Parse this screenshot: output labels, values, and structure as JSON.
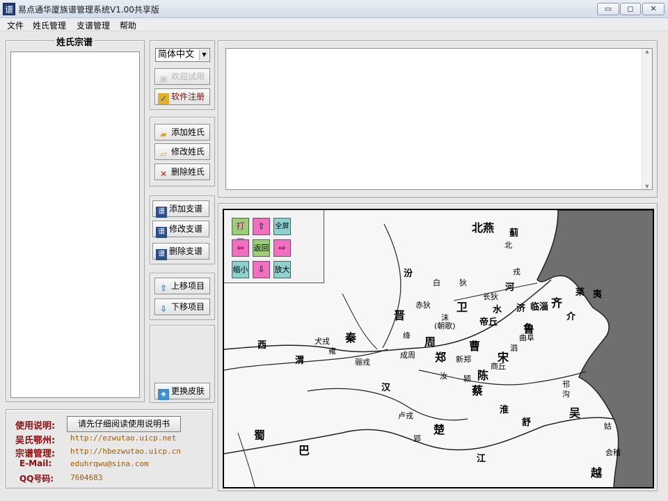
{
  "window": {
    "title": "易点通华厦族谱管理系统V1.00共享版",
    "icon": "谱"
  },
  "menu": [
    "文件",
    "姓氏管理",
    "支谱管理",
    "帮助"
  ],
  "surname_panel": {
    "title": "姓氏宗谱"
  },
  "language_select": {
    "value": "简体中文"
  },
  "buttons": {
    "trial": "欢迎试用",
    "register": "软件注册",
    "add_surname": "添加姓氏",
    "edit_surname": "修改姓氏",
    "delete_surname": "删除姓氏",
    "add_branch": "添加支谱",
    "edit_branch": "修改支谱",
    "delete_branch": "删除支谱",
    "move_up": "上移项目",
    "move_down": "下移项目",
    "change_skin": "更换皮肤"
  },
  "map_nav": {
    "open": "打开",
    "fullscreen": "全屏",
    "back": "返回",
    "zoom_out": "缩小",
    "zoom_in": "放大"
  },
  "map_labels": {
    "big": [
      "北燕",
      "齐",
      "鲁",
      "宋",
      "曹",
      "郑",
      "周",
      "秦",
      "晋",
      "卫",
      "陈",
      "蔡",
      "楚",
      "吴",
      "越",
      "蜀",
      "巴"
    ],
    "small": [
      "蓟",
      "北",
      "戎",
      "长狄",
      "河",
      "临淄",
      "济",
      "莱",
      "夷",
      "介",
      "曲阜",
      "泗",
      "帝丘",
      "水",
      "沫",
      "(朝歌)",
      "白",
      "狄",
      "赤狄",
      "汾",
      "绛",
      "成周",
      "新郑",
      "商丘",
      "淮",
      "邗",
      "沟",
      "汝",
      "颍",
      "犬戎",
      "雍",
      "渭",
      "骊戎",
      "西",
      "汉",
      "卢戎",
      "郢",
      "舒",
      "江",
      "会稽",
      "姑"
    ]
  },
  "info": {
    "usage_label": "使用说明:",
    "manual_button": "请先仔细阅读使用说明书",
    "wu_label": "吴氏鄂州:",
    "wu_url": "http://ezwutao.uicp.net",
    "genealogy_label": "宗谱管理:",
    "genealogy_url": "http://hbezwutao.uicp.cn",
    "email_label": "E-Mail:",
    "email": "eduhrqwu@sina.com",
    "qq_label": "QQ号码:",
    "qq": "7604683"
  }
}
